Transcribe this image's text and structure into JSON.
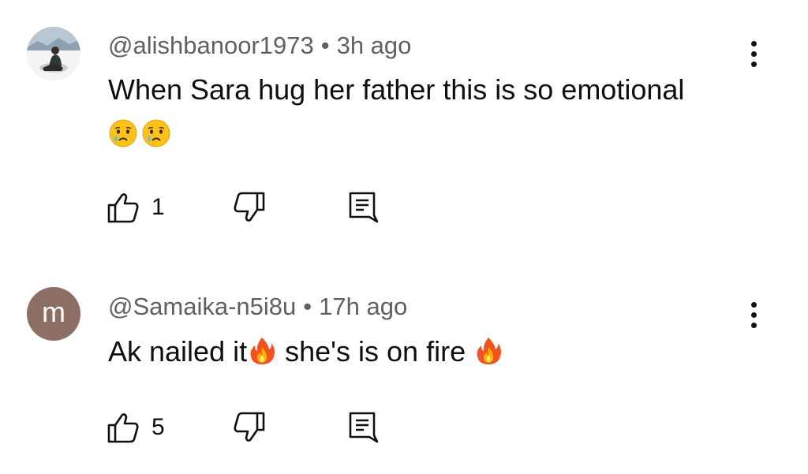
{
  "comments": [
    {
      "handle": "@alishbanoor1973",
      "separator": "•",
      "time": "3h ago",
      "text_line1": "When Sara hug her father this is so emotional",
      "emojis": [
        "crying-face",
        "crying-face"
      ],
      "likes": "1",
      "avatar": "photo"
    },
    {
      "handle": "@Samaika-n5i8u",
      "separator": "•",
      "time": "17h ago",
      "text_part1": "Ak nailed it",
      "text_part2": " she's is on fire ",
      "emojis": [
        "fire",
        "fire"
      ],
      "likes": "5",
      "avatar_letter": "m",
      "avatar_color": "#8d6e63"
    }
  ]
}
